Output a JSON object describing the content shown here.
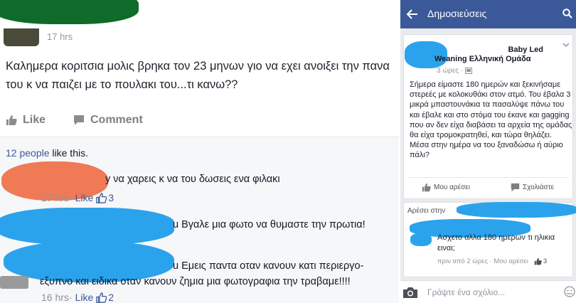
{
  "left": {
    "post": {
      "time": "17 hrs",
      "text": "Καλημερα κοριτσια μολις βρηκα τον 23 μηνων γιο να εχει ανοιξει την πανα του κ να παιζει με το πουλακι του...τι κανω??"
    },
    "actions": {
      "like": "Like",
      "comment": "Comment"
    },
    "likes": {
      "count": "12 people",
      "suffix": " like this."
    },
    "comments": [
      {
        "text": "y να χαρεις κ να του δωσεις ενα φιλακι",
        "time": "17 hrs",
        "like": "Like",
        "count": "3"
      },
      {
        "text": "u Βγαλε μια φωτο να θυμαστε την πρωτια!"
      },
      {
        "text_line1": "u Εμεις παντα οταν κανουν κατι περιεργο-",
        "text_line2": "εξυπνο και ειδικα οταν κανουν ζημια μια φωτογραφια την τραβαμε!!!!",
        "time": "16 hrs",
        "like": "Like",
        "count": "2"
      }
    ]
  },
  "right": {
    "topbar": {
      "title": "Δημοσιεύσεις"
    },
    "post": {
      "group_line1": "Baby Led",
      "group_line2": "Weaning Ελληνική Ομάδα",
      "time": "3 ώρες ·",
      "text": "Σήμερα είμαστε 180 ημερών και ξεκινήσαμε στερεές με κολοκυθάκι στον ατμό. Του έβαλα 3 μικρά μπαστουνάκια τα πασαλύψε πάνω του και έβαλε και στο στόμα του έκανε και gagging που αν δεν είχα διαβάσει τα αρχεία της ομάδας θα είχα τρομοκρατηθεί, και τώρα θηλάζει. Μέσα στην ημέρα να του ξαναδώσω ή αύριο πάλι?",
      "like": "Μου αρέσει",
      "comment": "Σχολιάστε"
    },
    "likes_label": "Αρέσει στην",
    "comment": {
      "text": "Ασχετο αλλα 180 ημερων τι ηλικια ειναι;",
      "time": "πριν από 2 ώρες · Μου αρέσει",
      "count": "3"
    },
    "input": {
      "placeholder": "Γράψτε ένα σχόλιο..."
    }
  },
  "colors": {
    "facebook_blue": "#3b5998",
    "censor_blue": "#2ba3ec",
    "censor_orange": "#f07a55",
    "censor_green": "#0f6b2a"
  },
  "icons": [
    "thumbs-up-icon",
    "comment-icon",
    "back-arrow-icon",
    "search-icon",
    "chevron-down-icon",
    "globe-icon",
    "camera-icon",
    "smiley-icon"
  ]
}
